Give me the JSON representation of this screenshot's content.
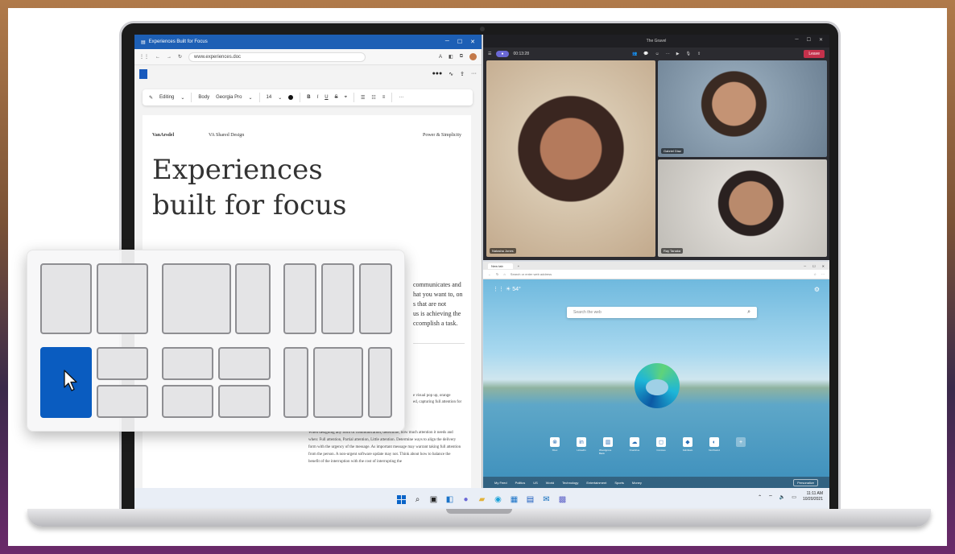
{
  "word": {
    "window_title": "Experiences Built for Focus",
    "url": "www.experiences.doc",
    "toolbar": {
      "mode": "Editing",
      "style": "Body",
      "font": "Georgia Pro",
      "size": "14",
      "bold": "B",
      "italic": "I",
      "underline": "U",
      "strike": "S",
      "more": "···"
    },
    "doc": {
      "brand": "VanArsdel",
      "header_center": "VA Shared Design",
      "header_right": "Power & Simplicity",
      "title_line1": "Experiences",
      "title_line2": "built for focus",
      "body_lines": [
        "communicates and",
        "hat you want to, on",
        "s that are not",
        "us is achieving the",
        "ccomplish a task."
      ],
      "mid_lines": [
        "e visual pop up, orange",
        "ed, capturing full attention for"
      ],
      "small_paragraph": "When designing any form of communication, determine, how much attention it needs and when: Full attention, Partial attention, Little attention. Determine ways to align the delivery form with the urgency of the message. As important message may warrant taking full attention from the person. A non-urgent software update may not. Think about how to balance the benefit of the interruption with the cost of interrupting the"
    }
  },
  "teams": {
    "window_title": "The Gravel",
    "timer": "00:13:28",
    "leave_label": "Leave",
    "participants": [
      {
        "name": "Natasha Jones"
      },
      {
        "name": "Gabriel Diaz"
      },
      {
        "name": "Ray Tanaka"
      }
    ]
  },
  "edge": {
    "tab_label": "New tab",
    "address_placeholder": "Search or enter web address",
    "weather": "54°",
    "search_placeholder": "Search the web",
    "quick_links": [
      "Xbox",
      "LinkedIn",
      "Woodgrove Bank",
      "OneDrive",
      "Contoso",
      "Fabrikam",
      "Northwind"
    ],
    "feed_tabs": [
      "My Feed",
      "Politics",
      "US",
      "World",
      "Technology",
      "Entertainment",
      "Sports",
      "Money"
    ],
    "personalize_label": "Personalize"
  },
  "taskbar": {
    "time": "11:11 AM",
    "date": "10/20/2021"
  },
  "colors": {
    "word_blue": "#1d5fb5",
    "snap_active": "#0a5cc0",
    "teams_leave": "#c4314b",
    "teams_pill": "#6b69d6"
  }
}
